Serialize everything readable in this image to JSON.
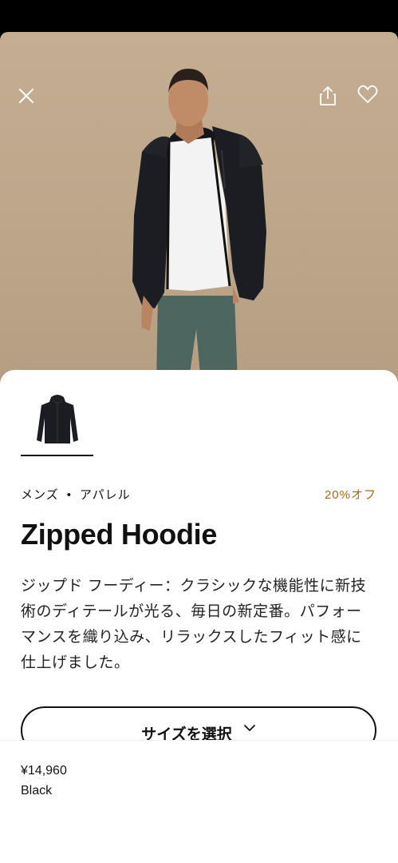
{
  "header": {
    "close_icon": "close-icon",
    "share_icon": "share-icon",
    "favorite_icon": "heart-icon"
  },
  "product": {
    "thumbnail_icon": "hoodie-thumbnail",
    "category_gender": "メンズ",
    "category_separator": "•",
    "category_type": "アパレル",
    "discount": "20%オフ",
    "name": "Zipped Hoodie",
    "description": "ジップド フーディー：クラシックな機能性に新技術のディテールが光る、毎日の新定番。パフォーマンスを織り込み、リラックスしたフィット感に仕上げました。",
    "price": "¥14,960",
    "color": "Black"
  },
  "actions": {
    "select_size_label": "サイズを選択",
    "select_size_icon": "chevron-down-icon"
  },
  "colors": {
    "discount": "#a06a1c",
    "hero_background": "#c4ad92"
  }
}
